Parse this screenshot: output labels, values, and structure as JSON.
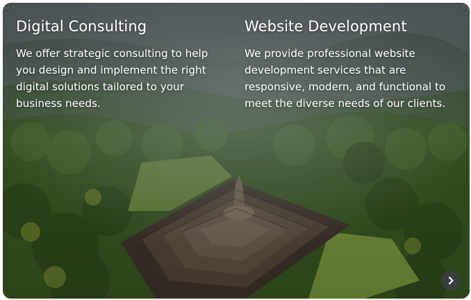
{
  "services": [
    {
      "title": "Digital Consulting",
      "description": "We  offer strategic consulting to help\nyou design and implement the right\ndigital solutions tailored to your\nbusiness needs."
    },
    {
      "title": "Website Development",
      "description": "We provide professional website\ndevelopment services that are\nresponsive, modern, and functional to\nmeet the diverse needs of our clients."
    }
  ],
  "carousel": {
    "next_icon": "chevron-right-icon"
  },
  "colors": {
    "text": "#ffffff",
    "button_bg": "#3c3e42",
    "forest": "#2f4a26",
    "temple": "#4a3f33"
  }
}
